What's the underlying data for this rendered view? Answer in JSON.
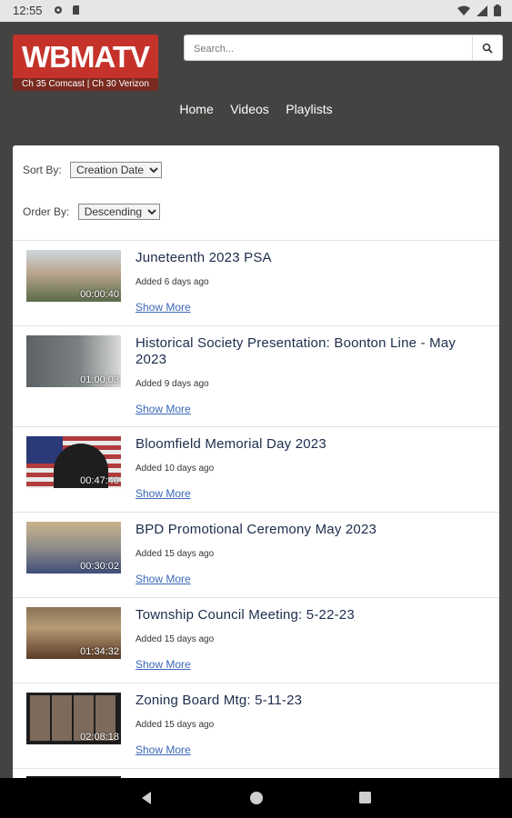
{
  "status": {
    "time": "12:55"
  },
  "header": {
    "logo_main": "WBMA",
    "logo_tv": "TV",
    "logo_sub": "Ch 35 Comcast | Ch 30 Verizon",
    "search_placeholder": "Search..."
  },
  "nav": {
    "home": "Home",
    "videos": "Videos",
    "playlists": "Playlists"
  },
  "filters": {
    "sort_label": "Sort By:",
    "sort_value": "Creation Date",
    "order_label": "Order By:",
    "order_value": "Descending"
  },
  "videos": [
    {
      "title": "Juneteenth 2023 PSA",
      "added": "Added 6 days ago",
      "duration": "00:00:40",
      "more": "Show More"
    },
    {
      "title": "Historical Society Presentation: Boonton Line - May 2023",
      "added": "Added 9 days ago",
      "duration": "01:00:03",
      "more": "Show More"
    },
    {
      "title": "Bloomfield Memorial Day 2023",
      "added": "Added 10 days ago",
      "duration": "00:47:40",
      "more": "Show More"
    },
    {
      "title": "BPD Promotional Ceremony May 2023",
      "added": "Added 15 days ago",
      "duration": "00:30:02",
      "more": "Show More"
    },
    {
      "title": "Township Council Meeting: 5-22-23",
      "added": "Added 15 days ago",
      "duration": "01:34:32",
      "more": "Show More"
    },
    {
      "title": "Zoning Board Mtg: 5-11-23",
      "added": "Added 15 days ago",
      "duration": "02:08:18",
      "more": "Show More"
    }
  ]
}
